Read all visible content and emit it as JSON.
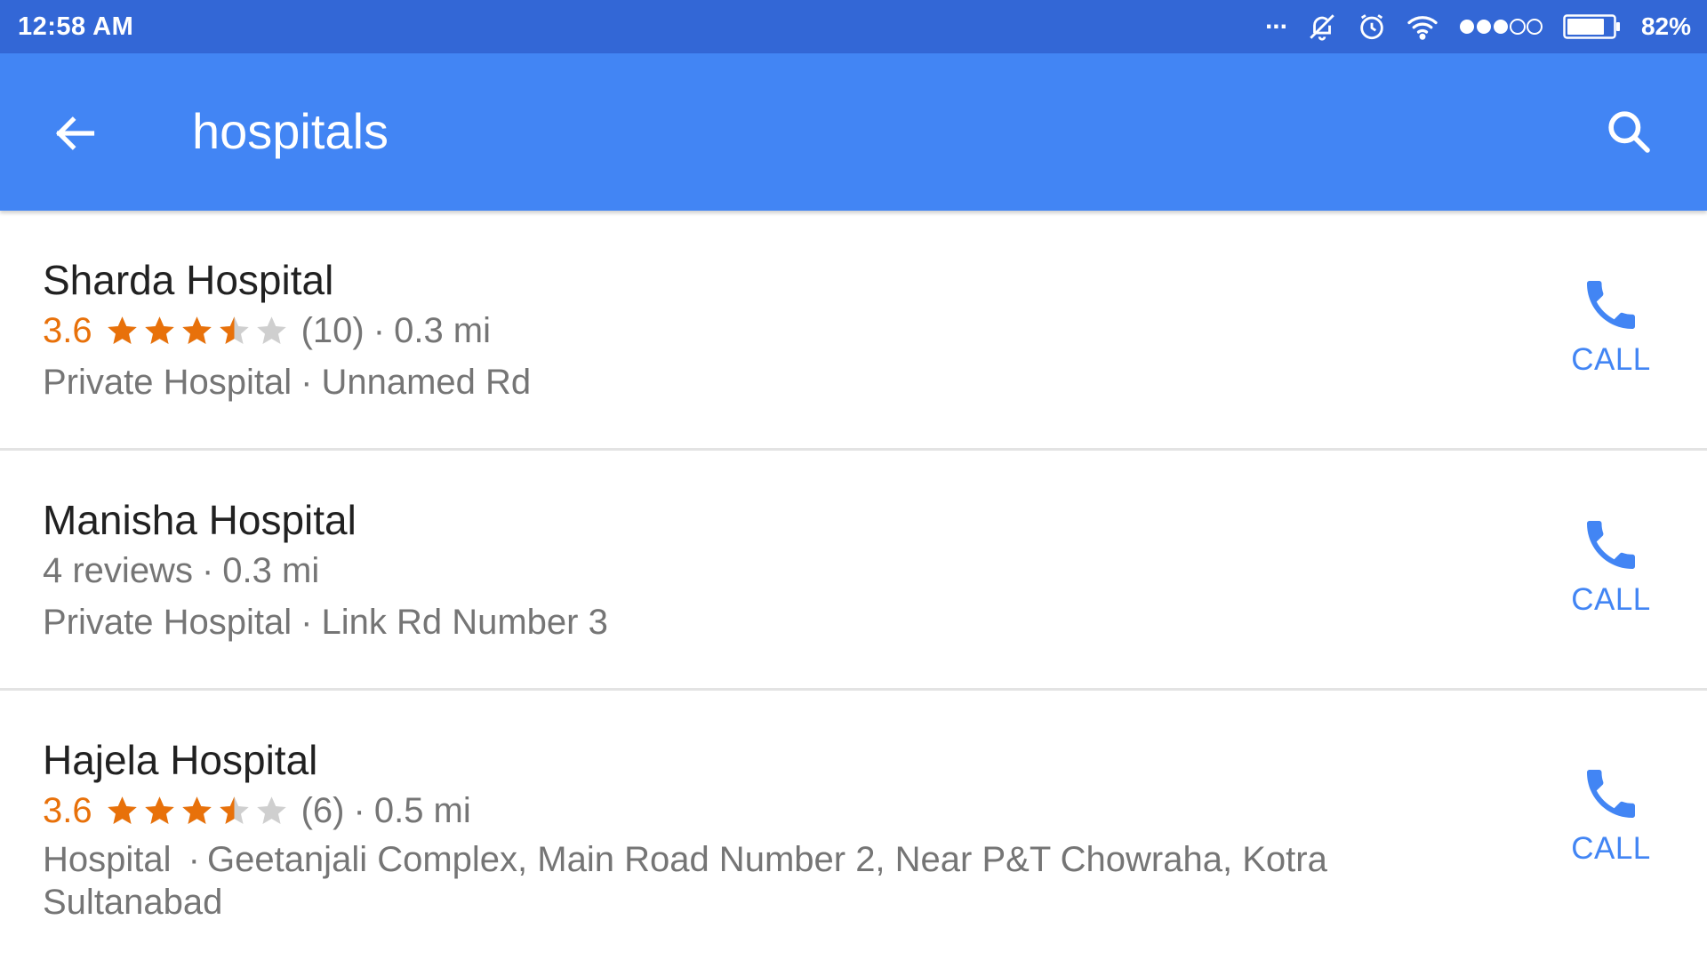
{
  "status_bar": {
    "time": "12:58 AM",
    "overflow_dots": "...",
    "battery": "82%",
    "icons": [
      "notifications-off-icon",
      "alarm-icon",
      "wifi-icon",
      "signal-icon",
      "battery-icon"
    ],
    "signal_level": 0.6,
    "battery_level": 0.82
  },
  "app_bar": {
    "query": "hospitals",
    "back_icon": "arrow-back-icon",
    "search_icon": "search-icon",
    "color": "#4285f4"
  },
  "colors": {
    "status_bar": "#3367d6",
    "rating": "#e8710a",
    "star_filled": "#e8710a",
    "star_empty": "#cfcfcf",
    "call": "#4285f4"
  },
  "results": [
    {
      "name": "Sharda Hospital",
      "rating": "3.6",
      "stars": 3.5,
      "reviews": "(10)",
      "separator": "·",
      "distance": "0.3 mi",
      "category": "Private Hospital",
      "address": "Unnamed Rd",
      "call_label": "CALL"
    },
    {
      "name": "Manisha Hospital",
      "reviews_text": "4 reviews",
      "separator": "·",
      "distance": "0.3 mi",
      "category": "Private Hospital",
      "address": "Link Rd Number 3",
      "call_label": "CALL"
    },
    {
      "name": "Hajela Hospital",
      "rating": "3.6",
      "stars": 3.5,
      "reviews": "(6)",
      "separator": "·",
      "distance": "0.5 mi",
      "category": "Hospital",
      "address": "Geetanjali Complex, Main Road Number 2, Near P&T Chowraha, Kotra Sultanabad",
      "call_label": "CALL"
    }
  ]
}
